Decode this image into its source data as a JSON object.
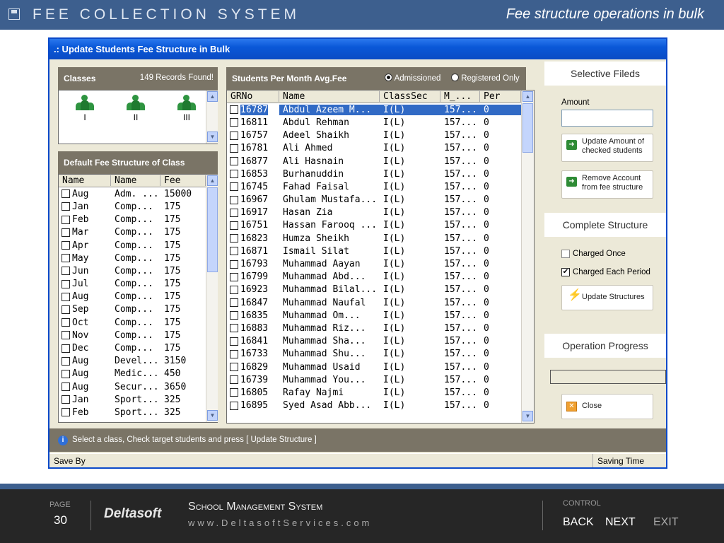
{
  "header": {
    "app_title": "FEE COLLECTION SYSTEM",
    "subtitle": "Fee structure operations in bulk"
  },
  "window": {
    "title": ".: Update Students Fee Structure in Bulk"
  },
  "classes": {
    "title": "Classes",
    "records": "149 Records Found!",
    "items": [
      {
        "label": "I"
      },
      {
        "label": "II"
      },
      {
        "label": "III"
      }
    ]
  },
  "default_fee": {
    "title": "Default Fee Structure of Class",
    "columns": [
      "Name",
      "Name",
      "Fee"
    ],
    "rows": [
      {
        "month": "Aug",
        "name": "Adm. ...",
        "fee": "15000"
      },
      {
        "month": "Jan",
        "name": "Comp...",
        "fee": "175"
      },
      {
        "month": "Feb",
        "name": "Comp...",
        "fee": "175"
      },
      {
        "month": "Mar",
        "name": "Comp...",
        "fee": "175"
      },
      {
        "month": "Apr",
        "name": "Comp...",
        "fee": "175"
      },
      {
        "month": "May",
        "name": "Comp...",
        "fee": "175"
      },
      {
        "month": "Jun",
        "name": "Comp...",
        "fee": "175"
      },
      {
        "month": "Jul",
        "name": "Comp...",
        "fee": "175"
      },
      {
        "month": "Aug",
        "name": "Comp...",
        "fee": "175"
      },
      {
        "month": "Sep",
        "name": "Comp...",
        "fee": "175"
      },
      {
        "month": "Oct",
        "name": "Comp...",
        "fee": "175"
      },
      {
        "month": "Nov",
        "name": "Comp...",
        "fee": "175"
      },
      {
        "month": "Dec",
        "name": "Comp...",
        "fee": "175"
      },
      {
        "month": "Aug",
        "name": "Devel...",
        "fee": "3150"
      },
      {
        "month": "Aug",
        "name": "Medic...",
        "fee": "450"
      },
      {
        "month": "Aug",
        "name": "Secur...",
        "fee": "3650"
      },
      {
        "month": "Jan",
        "name": "Sport...",
        "fee": "325"
      },
      {
        "month": "Feb",
        "name": "Sport...",
        "fee": "325"
      }
    ]
  },
  "students": {
    "title": "Students Per Month Avg.Fee",
    "radio_admissioned": "Admissioned",
    "radio_registered": "Registered Only",
    "columns": [
      "GRNo",
      "Name",
      "ClassSec",
      "M_...",
      "Per"
    ],
    "rows": [
      {
        "grno": "16787",
        "name": "Abdul Azeem M...",
        "classsec": "I(L)",
        "m": "157...",
        "per": "0"
      },
      {
        "grno": "16811",
        "name": "Abdul Rehman",
        "classsec": "I(L)",
        "m": "157...",
        "per": "0"
      },
      {
        "grno": "16757",
        "name": "Adeel Shaikh",
        "classsec": "I(L)",
        "m": "157...",
        "per": "0"
      },
      {
        "grno": "16781",
        "name": "Ali Ahmed",
        "classsec": "I(L)",
        "m": "157...",
        "per": "0"
      },
      {
        "grno": "16877",
        "name": "Ali Hasnain",
        "classsec": "I(L)",
        "m": "157...",
        "per": "0"
      },
      {
        "grno": "16853",
        "name": "Burhanuddin",
        "classsec": "I(L)",
        "m": "157...",
        "per": "0"
      },
      {
        "grno": "16745",
        "name": "Fahad Faisal",
        "classsec": "I(L)",
        "m": "157...",
        "per": "0"
      },
      {
        "grno": "16967",
        "name": "Ghulam Mustafa...",
        "classsec": "I(L)",
        "m": "157...",
        "per": "0"
      },
      {
        "grno": "16917",
        "name": "Hasan Zia",
        "classsec": "I(L)",
        "m": "157...",
        "per": "0"
      },
      {
        "grno": "16751",
        "name": "Hassan Farooq ...",
        "classsec": "I(L)",
        "m": "157...",
        "per": "0"
      },
      {
        "grno": "16823",
        "name": "Humza Sheikh",
        "classsec": "I(L)",
        "m": "157...",
        "per": "0"
      },
      {
        "grno": "16871",
        "name": "Ismail Silat",
        "classsec": "I(L)",
        "m": "157...",
        "per": "0"
      },
      {
        "grno": "16793",
        "name": "Muhammad Aayan",
        "classsec": "I(L)",
        "m": "157...",
        "per": "0"
      },
      {
        "grno": "16799",
        "name": "Muhammad Abd...",
        "classsec": "I(L)",
        "m": "157...",
        "per": "0"
      },
      {
        "grno": "16923",
        "name": "Muhammad Bilal...",
        "classsec": "I(L)",
        "m": "157...",
        "per": "0"
      },
      {
        "grno": "16847",
        "name": "Muhammad Naufal",
        "classsec": "I(L)",
        "m": "157...",
        "per": "0"
      },
      {
        "grno": "16835",
        "name": "Muhammad Om...",
        "classsec": "I(L)",
        "m": "157...",
        "per": "0"
      },
      {
        "grno": "16883",
        "name": "Muhammad Riz...",
        "classsec": "I(L)",
        "m": "157...",
        "per": "0"
      },
      {
        "grno": "16841",
        "name": "Muhammad Sha...",
        "classsec": "I(L)",
        "m": "157...",
        "per": "0"
      },
      {
        "grno": "16733",
        "name": "Muhammad Shu...",
        "classsec": "I(L)",
        "m": "157...",
        "per": "0"
      },
      {
        "grno": "16829",
        "name": "Muhammad Usaid",
        "classsec": "I(L)",
        "m": "157...",
        "per": "0"
      },
      {
        "grno": "16739",
        "name": "Muhammad You...",
        "classsec": "I(L)",
        "m": "157...",
        "per": "0"
      },
      {
        "grno": "16805",
        "name": "Rafay Najmi",
        "classsec": "I(L)",
        "m": "157...",
        "per": "0"
      },
      {
        "grno": "16895",
        "name": "Syed Asad Abb...",
        "classsec": "I(L)",
        "m": "157...",
        "per": "0"
      }
    ]
  },
  "right": {
    "selective_title": "Selective Fileds",
    "amount_label": "Amount",
    "amount_value": "",
    "update_amount_btn": "Update Amount of checked students",
    "remove_account_btn": "Remove Account from fee structure",
    "complete_title": "Complete Structure",
    "charged_once": "Charged Once",
    "charged_each": "Charged Each Period",
    "update_structures_btn": "Update Structures",
    "progress_title": "Operation Progress",
    "progress_value": 0,
    "close_btn": "Close"
  },
  "status": {
    "message": "Select a class, Check target students and press [ Update Structure ]",
    "left": "Save By",
    "right": "Saving Time"
  },
  "footer": {
    "page_label": "PAGE",
    "page_number": "30",
    "brand": "Deltasoft",
    "system_title": "School Management System",
    "website": "www.DeltasoftServices.com",
    "control_label": "CONTROL",
    "back": "BACK",
    "next": "NEXT",
    "exit": "EXIT"
  }
}
